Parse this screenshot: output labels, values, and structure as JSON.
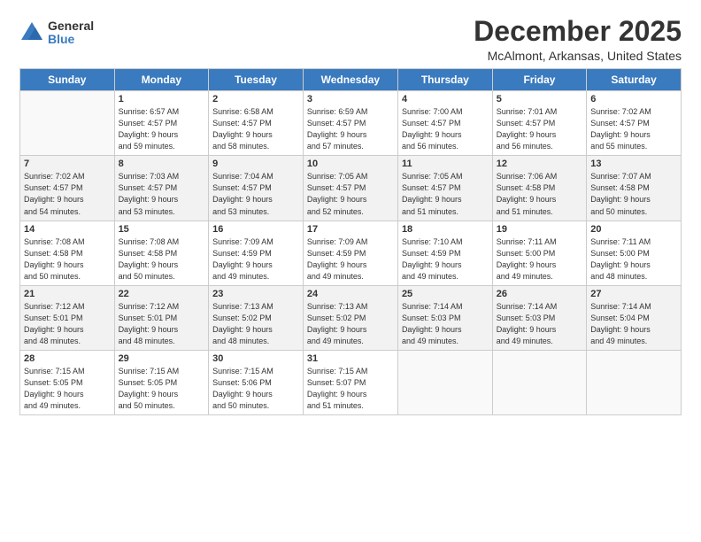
{
  "logo": {
    "general": "General",
    "blue": "Blue"
  },
  "title": "December 2025",
  "subtitle": "McAlmont, Arkansas, United States",
  "headers": [
    "Sunday",
    "Monday",
    "Tuesday",
    "Wednesday",
    "Thursday",
    "Friday",
    "Saturday"
  ],
  "weeks": [
    [
      {
        "day": "",
        "info": ""
      },
      {
        "day": "1",
        "info": "Sunrise: 6:57 AM\nSunset: 4:57 PM\nDaylight: 9 hours\nand 59 minutes."
      },
      {
        "day": "2",
        "info": "Sunrise: 6:58 AM\nSunset: 4:57 PM\nDaylight: 9 hours\nand 58 minutes."
      },
      {
        "day": "3",
        "info": "Sunrise: 6:59 AM\nSunset: 4:57 PM\nDaylight: 9 hours\nand 57 minutes."
      },
      {
        "day": "4",
        "info": "Sunrise: 7:00 AM\nSunset: 4:57 PM\nDaylight: 9 hours\nand 56 minutes."
      },
      {
        "day": "5",
        "info": "Sunrise: 7:01 AM\nSunset: 4:57 PM\nDaylight: 9 hours\nand 56 minutes."
      },
      {
        "day": "6",
        "info": "Sunrise: 7:02 AM\nSunset: 4:57 PM\nDaylight: 9 hours\nand 55 minutes."
      }
    ],
    [
      {
        "day": "7",
        "info": "Sunrise: 7:02 AM\nSunset: 4:57 PM\nDaylight: 9 hours\nand 54 minutes."
      },
      {
        "day": "8",
        "info": "Sunrise: 7:03 AM\nSunset: 4:57 PM\nDaylight: 9 hours\nand 53 minutes."
      },
      {
        "day": "9",
        "info": "Sunrise: 7:04 AM\nSunset: 4:57 PM\nDaylight: 9 hours\nand 53 minutes."
      },
      {
        "day": "10",
        "info": "Sunrise: 7:05 AM\nSunset: 4:57 PM\nDaylight: 9 hours\nand 52 minutes."
      },
      {
        "day": "11",
        "info": "Sunrise: 7:05 AM\nSunset: 4:57 PM\nDaylight: 9 hours\nand 51 minutes."
      },
      {
        "day": "12",
        "info": "Sunrise: 7:06 AM\nSunset: 4:58 PM\nDaylight: 9 hours\nand 51 minutes."
      },
      {
        "day": "13",
        "info": "Sunrise: 7:07 AM\nSunset: 4:58 PM\nDaylight: 9 hours\nand 50 minutes."
      }
    ],
    [
      {
        "day": "14",
        "info": "Sunrise: 7:08 AM\nSunset: 4:58 PM\nDaylight: 9 hours\nand 50 minutes."
      },
      {
        "day": "15",
        "info": "Sunrise: 7:08 AM\nSunset: 4:58 PM\nDaylight: 9 hours\nand 50 minutes."
      },
      {
        "day": "16",
        "info": "Sunrise: 7:09 AM\nSunset: 4:59 PM\nDaylight: 9 hours\nand 49 minutes."
      },
      {
        "day": "17",
        "info": "Sunrise: 7:09 AM\nSunset: 4:59 PM\nDaylight: 9 hours\nand 49 minutes."
      },
      {
        "day": "18",
        "info": "Sunrise: 7:10 AM\nSunset: 4:59 PM\nDaylight: 9 hours\nand 49 minutes."
      },
      {
        "day": "19",
        "info": "Sunrise: 7:11 AM\nSunset: 5:00 PM\nDaylight: 9 hours\nand 49 minutes."
      },
      {
        "day": "20",
        "info": "Sunrise: 7:11 AM\nSunset: 5:00 PM\nDaylight: 9 hours\nand 48 minutes."
      }
    ],
    [
      {
        "day": "21",
        "info": "Sunrise: 7:12 AM\nSunset: 5:01 PM\nDaylight: 9 hours\nand 48 minutes."
      },
      {
        "day": "22",
        "info": "Sunrise: 7:12 AM\nSunset: 5:01 PM\nDaylight: 9 hours\nand 48 minutes."
      },
      {
        "day": "23",
        "info": "Sunrise: 7:13 AM\nSunset: 5:02 PM\nDaylight: 9 hours\nand 48 minutes."
      },
      {
        "day": "24",
        "info": "Sunrise: 7:13 AM\nSunset: 5:02 PM\nDaylight: 9 hours\nand 49 minutes."
      },
      {
        "day": "25",
        "info": "Sunrise: 7:14 AM\nSunset: 5:03 PM\nDaylight: 9 hours\nand 49 minutes."
      },
      {
        "day": "26",
        "info": "Sunrise: 7:14 AM\nSunset: 5:03 PM\nDaylight: 9 hours\nand 49 minutes."
      },
      {
        "day": "27",
        "info": "Sunrise: 7:14 AM\nSunset: 5:04 PM\nDaylight: 9 hours\nand 49 minutes."
      }
    ],
    [
      {
        "day": "28",
        "info": "Sunrise: 7:15 AM\nSunset: 5:05 PM\nDaylight: 9 hours\nand 49 minutes."
      },
      {
        "day": "29",
        "info": "Sunrise: 7:15 AM\nSunset: 5:05 PM\nDaylight: 9 hours\nand 50 minutes."
      },
      {
        "day": "30",
        "info": "Sunrise: 7:15 AM\nSunset: 5:06 PM\nDaylight: 9 hours\nand 50 minutes."
      },
      {
        "day": "31",
        "info": "Sunrise: 7:15 AM\nSunset: 5:07 PM\nDaylight: 9 hours\nand 51 minutes."
      },
      {
        "day": "",
        "info": ""
      },
      {
        "day": "",
        "info": ""
      },
      {
        "day": "",
        "info": ""
      }
    ]
  ]
}
